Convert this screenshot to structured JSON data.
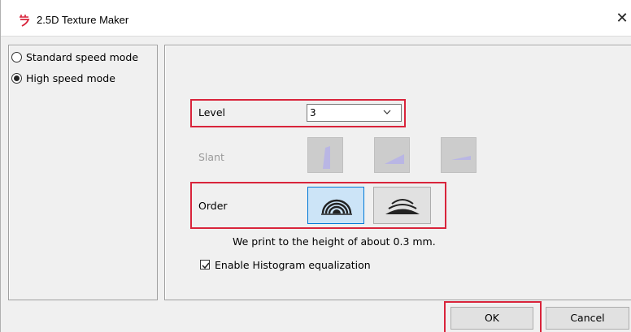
{
  "window": {
    "title": "2.5D Texture Maker",
    "close_label": "✕",
    "app_icon": "app-logo-icon"
  },
  "mode": {
    "options": [
      {
        "label": "Standard speed mode",
        "checked": false
      },
      {
        "label": "High speed mode",
        "checked": true
      }
    ]
  },
  "settings": {
    "level_label": "Level",
    "level_value": "3",
    "slant_label": "Slant",
    "order_label": "Order",
    "info_text": "We print to the height of about 0.3 mm.",
    "histogram_label": "Enable Histogram equalization",
    "histogram_checked": true
  },
  "footer": {
    "ok_label": "OK",
    "cancel_label": "Cancel"
  },
  "colors": {
    "highlight": "#d9243b",
    "selected_button": "#cce4f7",
    "selected_border": "#0078d7",
    "slant_icon_disabled": "#b9b6e4"
  }
}
